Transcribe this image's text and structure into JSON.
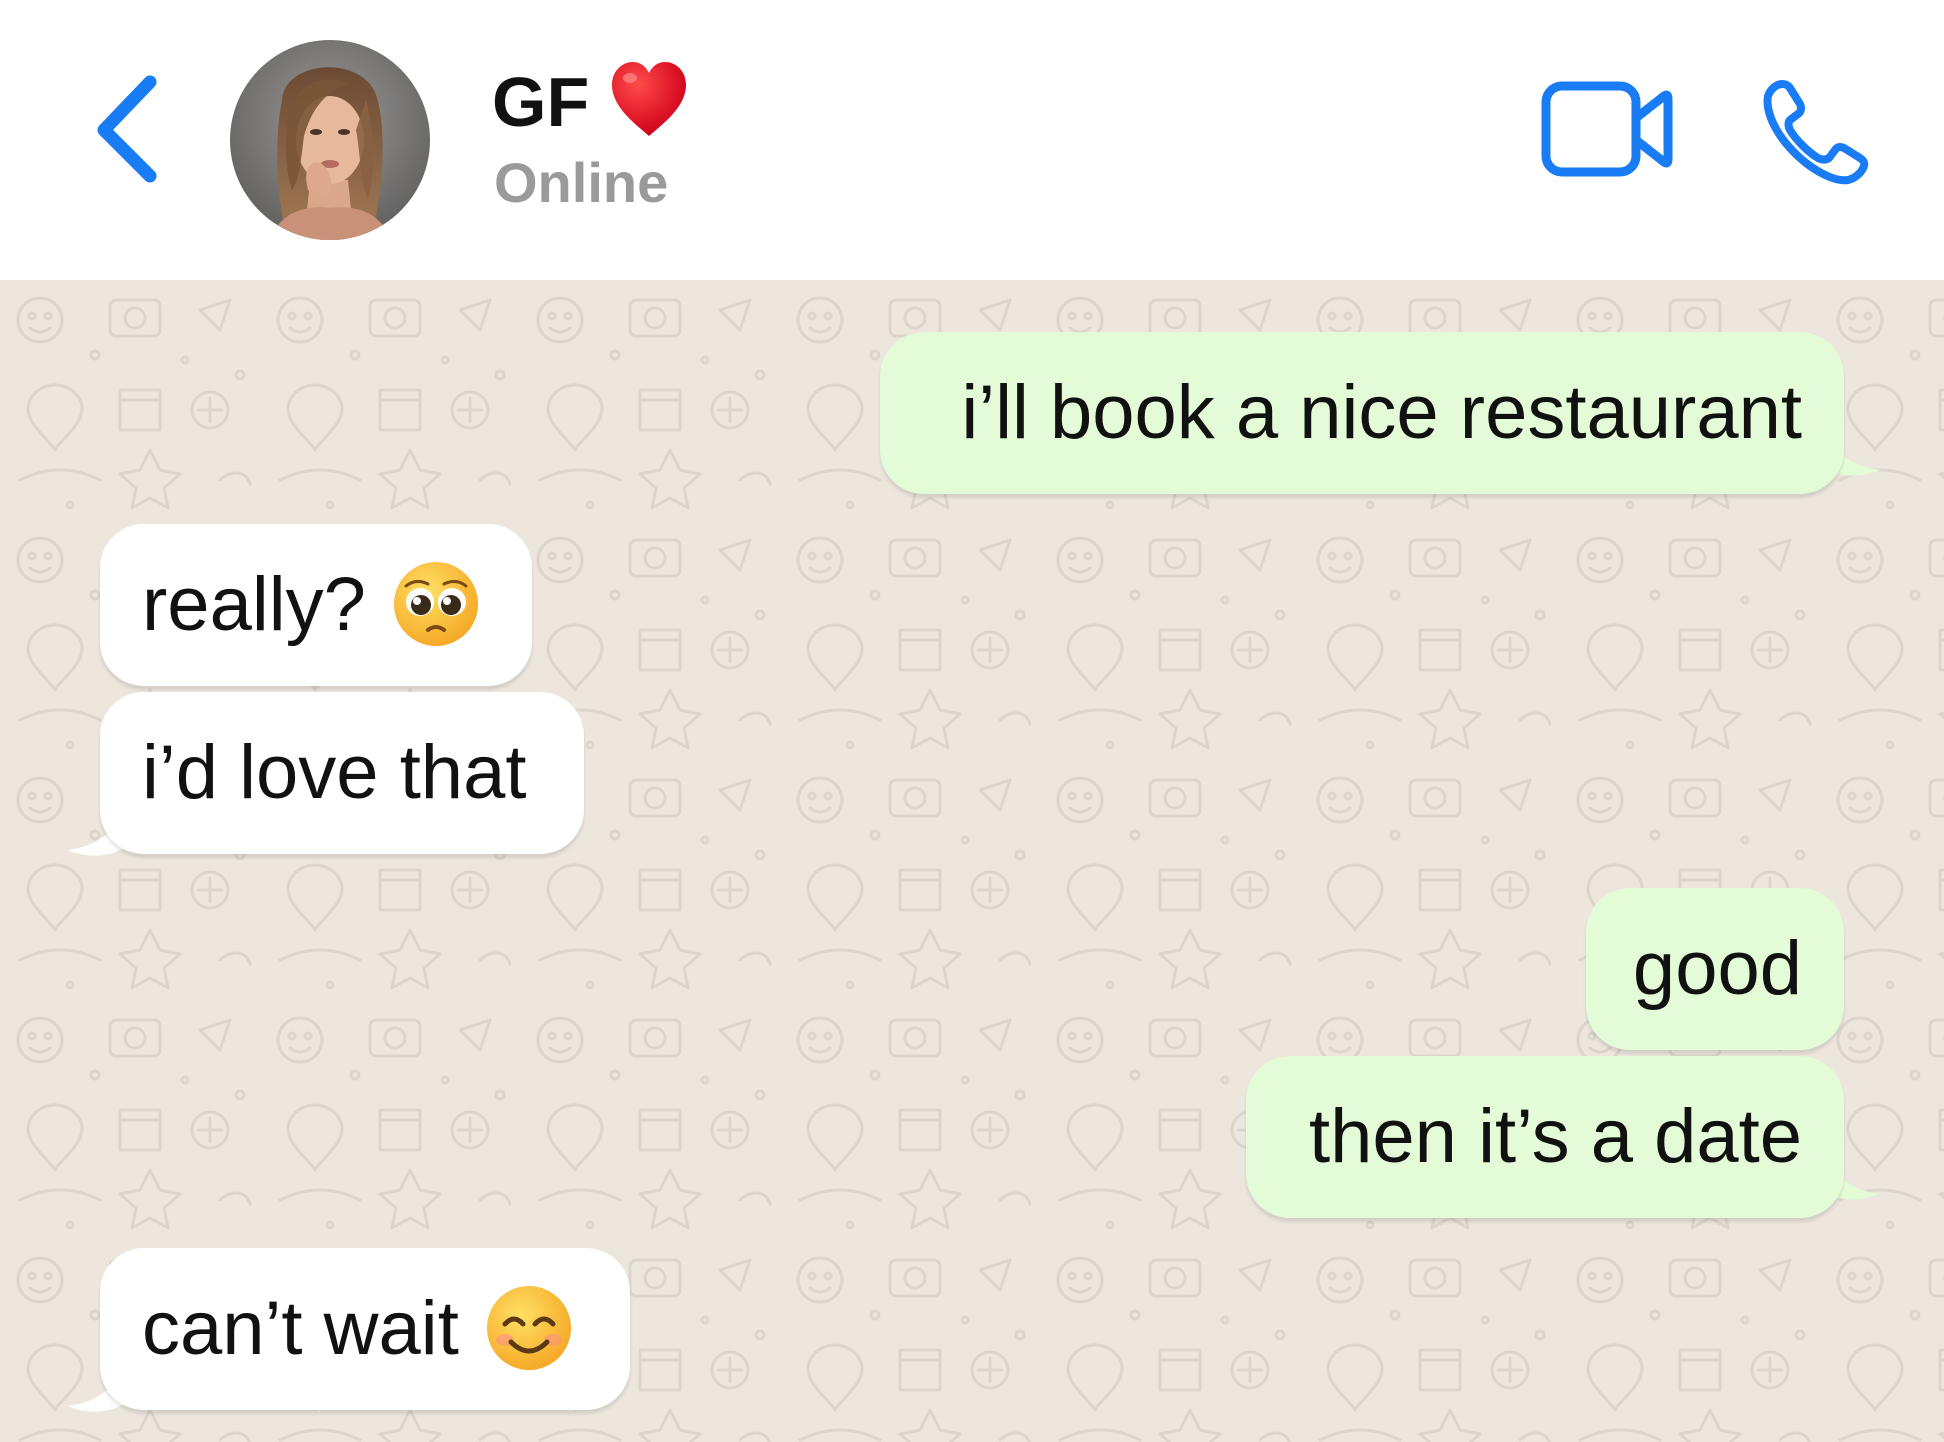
{
  "header": {
    "back_icon": "chevron-left-icon",
    "contact_name": "GF",
    "contact_name_emoji": "red-heart",
    "status": "Online",
    "video_icon": "video-camera-icon",
    "phone_icon": "phone-icon"
  },
  "colors": {
    "accent": "#1a7cf5",
    "outgoing_bubble": "#e3fbd7",
    "incoming_bubble": "#ffffff",
    "chat_background": "#ece6dd",
    "status_text": "#9a9a9a"
  },
  "messages": [
    {
      "direction": "outgoing",
      "text": "i’ll book a nice restaurant"
    },
    {
      "direction": "incoming",
      "text": "really?",
      "emoji": "pleading-face"
    },
    {
      "direction": "incoming",
      "text": "i’d love that"
    },
    {
      "direction": "outgoing",
      "text": "good"
    },
    {
      "direction": "outgoing",
      "text": "then it’s a date"
    },
    {
      "direction": "incoming",
      "text": "can’t wait",
      "emoji": "smiling-face-with-smiling-eyes"
    }
  ]
}
